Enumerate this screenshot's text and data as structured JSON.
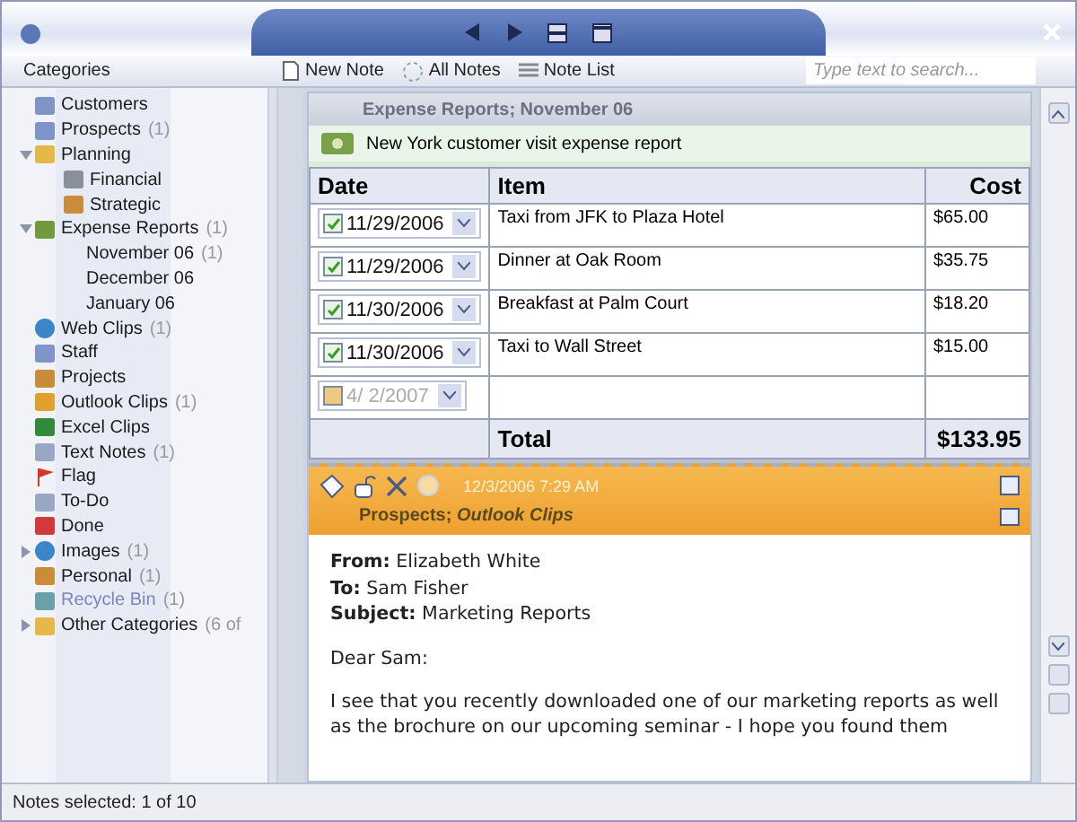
{
  "toolbar": {
    "categories_label": "Categories",
    "buttons": [
      {
        "kind": "new",
        "label": "New Note"
      },
      {
        "kind": "all",
        "label": "All Notes"
      },
      {
        "kind": "list",
        "label": "Note List"
      }
    ],
    "search": {
      "placeholder": "Type text to search..."
    }
  },
  "sidebar": {
    "items": [
      {
        "label": "Customers"
      },
      {
        "label": "Prospects",
        "count": "(1)"
      },
      {
        "label": "Planning",
        "expanded": true,
        "children": [
          {
            "label": "Financial"
          },
          {
            "label": "Strategic"
          }
        ]
      },
      {
        "label": "Expense Reports",
        "count": "(1)",
        "expanded": true,
        "children": [
          {
            "label": "November 06",
            "count": "(1)"
          },
          {
            "label": "December 06"
          },
          {
            "label": "January 06"
          }
        ]
      },
      {
        "label": "Web Clips",
        "count": "(1)"
      },
      {
        "label": "Staff"
      },
      {
        "label": "Projects"
      },
      {
        "label": "Outlook Clips",
        "count": "(1)"
      },
      {
        "label": "Excel Clips"
      },
      {
        "label": "Text Notes",
        "count": "(1)"
      },
      {
        "label": "Flag"
      },
      {
        "label": "To-Do"
      },
      {
        "label": "Done"
      },
      {
        "label": "Images",
        "count": "(1)",
        "expanded": false
      },
      {
        "label": "Personal",
        "count": "(1)"
      },
      {
        "label": "Recycle Bin",
        "count": "(1)",
        "disabled": true
      },
      {
        "label": "Other Categories",
        "count": "(6 of",
        "expanded": false
      }
    ]
  },
  "notes": [
    {
      "kind": "table",
      "header": "Expense Reports; November 06",
      "title": "New York customer visit expense report",
      "table": {
        "columns": [
          "Date",
          "Item",
          "Cost"
        ],
        "rows": [
          {
            "date": "11/29/2006",
            "checked": true,
            "item": "Taxi from JFK to Plaza Hotel",
            "cost": "$65.00"
          },
          {
            "date": "11/29/2006",
            "checked": true,
            "item": "Dinner at Oak Room",
            "cost": "$35.75"
          },
          {
            "date": "11/30/2006",
            "checked": true,
            "item": "Breakfast at Palm Court",
            "cost": "$18.20"
          },
          {
            "date": "11/30/2006",
            "checked": true,
            "item": "Taxi to Wall Street",
            "cost": "$15.00"
          },
          {
            "date": "4/ 2/2007",
            "checked": false
          }
        ],
        "total_label": "Total",
        "total": "$133.95"
      }
    },
    {
      "kind": "email",
      "timestamp": "12/3/2006 7:29 AM",
      "header": "Prospects; *Outlook Clips*",
      "fields": [
        "**From:** Elizabeth White",
        "**To:** Sam Fisher",
        "**Subject:** Marketing Reports"
      ],
      "paragraphs": [
        "Dear Sam:",
        "I see that you recently downloaded one of our marketing reports as well as the brochure on our upcoming seminar - I hope you found them"
      ]
    }
  ],
  "status_bar": "Notes selected: 1 of 10"
}
